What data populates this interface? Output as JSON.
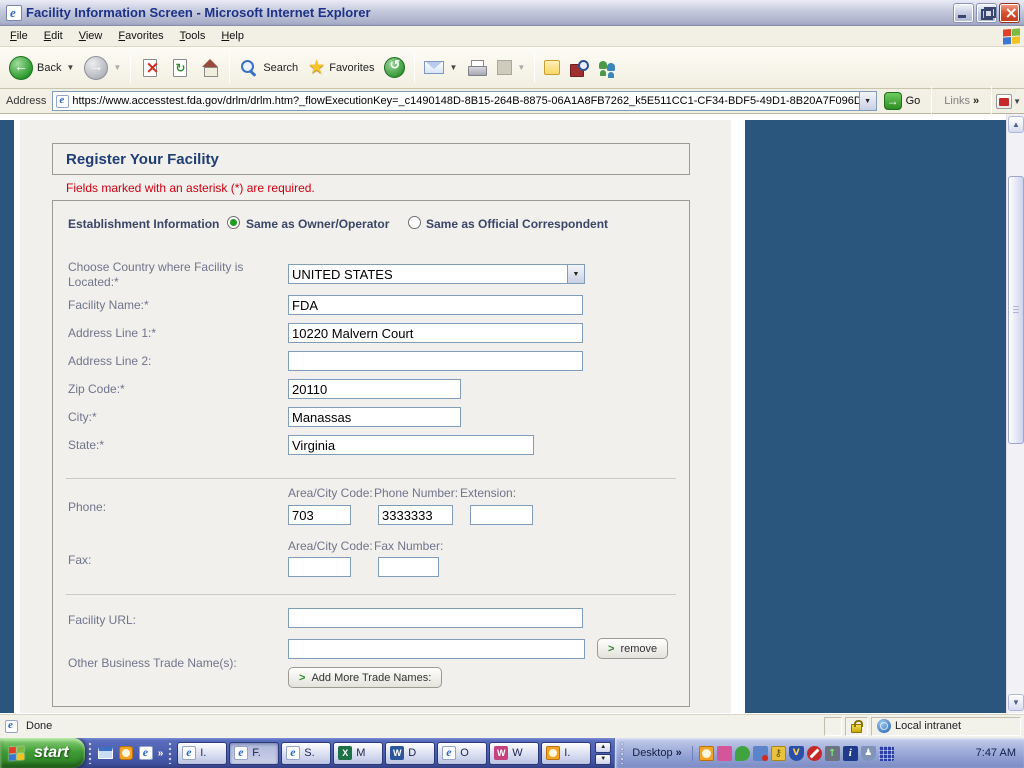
{
  "titlebar": {
    "title": "Facility Information Screen - Microsoft Internet Explorer"
  },
  "menubar": {
    "items": [
      "File",
      "Edit",
      "View",
      "Favorites",
      "Tools",
      "Help"
    ]
  },
  "toolbar": {
    "back": "Back",
    "search": "Search",
    "favorites": "Favorites"
  },
  "addressbar": {
    "label": "Address",
    "url": "https://www.accesstest.fda.gov/drlm/drlm.htm?_flowExecutionKey=_c1490148D-8B15-264B-8875-06A1A8FB7262_k5E511CC1-CF34-BDF5-49D1-8B20A7F096D",
    "go": "Go",
    "links": "Links"
  },
  "page": {
    "header": "Register Your Facility",
    "required_note": "Fields marked with an asterisk (*) are required.",
    "establishment": {
      "label": "Establishment Information",
      "option_owner": "Same as Owner/Operator",
      "option_correspondent": "Same as Official Correspondent",
      "selected": "Same as Owner/Operator"
    },
    "country": {
      "label": "Choose Country where Facility is Located:*",
      "value": "UNITED STATES"
    },
    "facility_name": {
      "label": "Facility Name:*",
      "value": "FDA"
    },
    "address_line1": {
      "label": "Address Line 1:*",
      "value": "10220 Malvern Court"
    },
    "address_line2": {
      "label": "Address Line 2:",
      "value": ""
    },
    "zip": {
      "label": "Zip Code:*",
      "value": "20110"
    },
    "city": {
      "label": "City:*",
      "value": "Manassas"
    },
    "state": {
      "label": "State:*",
      "value": "Virginia"
    },
    "phone": {
      "label": "Phone:",
      "area_label": "Area/City Code:",
      "number_label": "Phone Number:",
      "ext_label": "Extension:",
      "area": "703",
      "number": "3333333",
      "ext": ""
    },
    "fax": {
      "label": "Fax:",
      "area_label": "Area/City Code:",
      "number_label": "Fax Number:",
      "area": "",
      "number": ""
    },
    "facility_url": {
      "label": "Facility URL:",
      "value": ""
    },
    "trade_names": {
      "label": "Other Business Trade Name(s):",
      "value": "",
      "remove_button": "remove",
      "add_button": "Add More Trade Names:"
    }
  },
  "statusbar": {
    "status": "Done",
    "zone": "Local intranet"
  },
  "taskbar": {
    "start": "start",
    "buttons": [
      {
        "label": "I.",
        "app": "ie"
      },
      {
        "label": "F.",
        "app": "ie",
        "active": true
      },
      {
        "label": "S.",
        "app": "ie"
      },
      {
        "label": "M",
        "app": "excel"
      },
      {
        "label": "D",
        "app": "word"
      },
      {
        "label": "O",
        "app": "ie"
      },
      {
        "label": "W",
        "app": "other"
      },
      {
        "label": "I.",
        "app": "clock"
      }
    ],
    "desktop_label": "Desktop",
    "clock": "7:47 AM"
  },
  "icons": {
    "back": "←",
    "forward": "→",
    "stop": "×",
    "refresh": "↻",
    "home": "⌂",
    "search": "magnifier",
    "favorites": "star",
    "history": "clock-with-arrow",
    "mail": "envelope",
    "print": "printer",
    "edit": "edit-page",
    "discuss": "note",
    "research": "book-magnifier",
    "messenger": "two-people",
    "go": "green-arrow",
    "links_chevron": "»",
    "dropdown": "▾",
    "lock": "padlock",
    "zone": "globe",
    "start_flag": "windows-flag",
    "pdf": "adobe-pdf"
  }
}
